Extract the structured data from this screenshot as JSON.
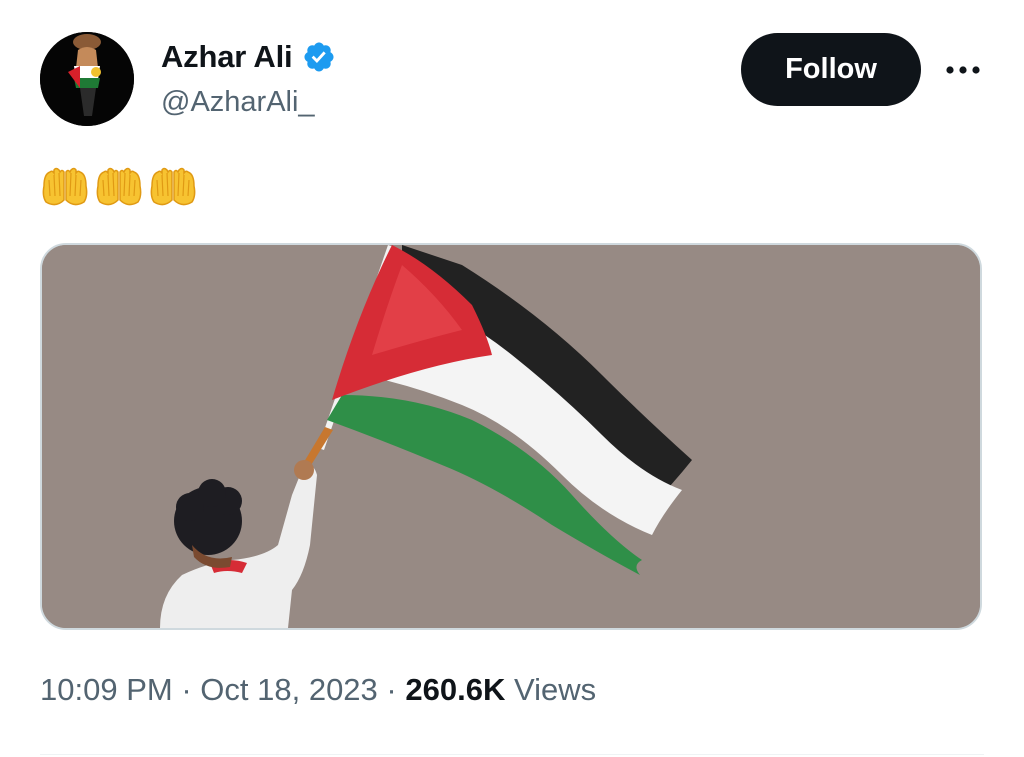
{
  "tweet": {
    "author": {
      "display_name": "Azhar Ali",
      "handle": "@AzharAli_",
      "verified": true,
      "verified_color": "#1d9bf0",
      "avatar_icon": "avatar-image"
    },
    "follow_label": "Follow",
    "more_icon": "more-icon",
    "text_emojis": [
      "palms-up-together-emoji",
      "palms-up-together-emoji",
      "palms-up-together-emoji"
    ],
    "media_icon": "palestinian-flag-illustration",
    "meta": {
      "time": "10:09 PM",
      "separator": "·",
      "date": "Oct 18, 2023",
      "views_count": "260.6K",
      "views_label": "Views"
    }
  },
  "colors": {
    "follow_bg": "#0f1419",
    "secondary_text": "#536471",
    "media_bg": "#978a84"
  }
}
